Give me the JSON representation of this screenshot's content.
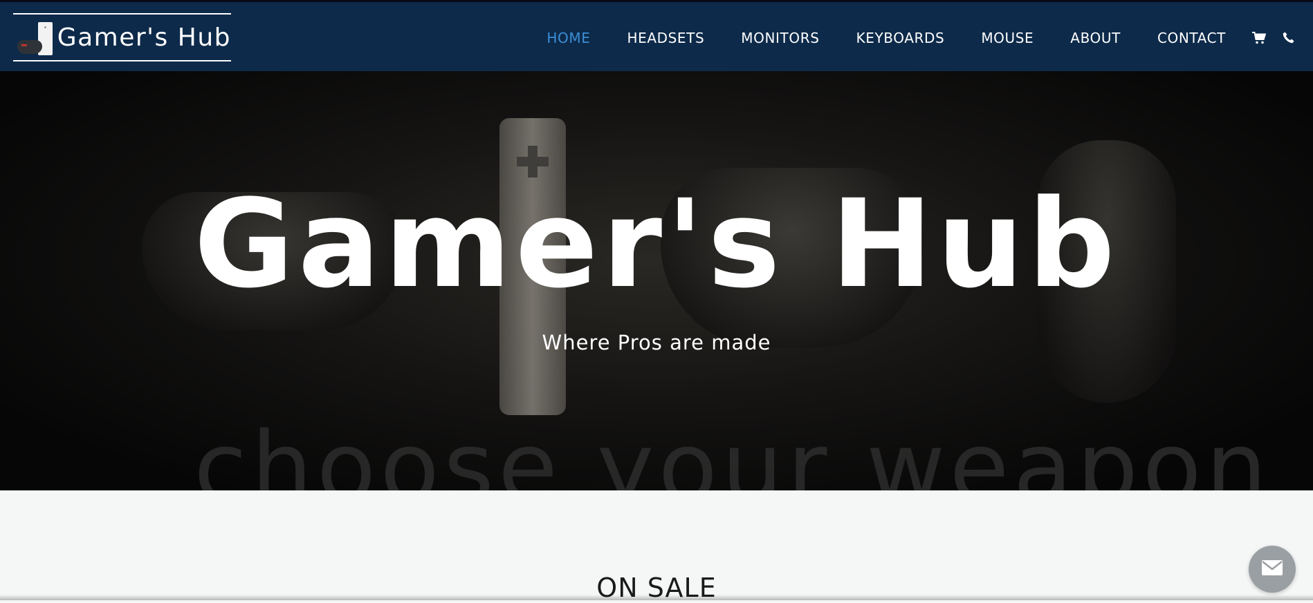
{
  "brand": {
    "name": "Gamer's Hub",
    "logo_icon": "console-controller-logo"
  },
  "nav": {
    "items": [
      {
        "label": "HOME",
        "active": true
      },
      {
        "label": "HEADSETS",
        "active": false
      },
      {
        "label": "MONITORS",
        "active": false
      },
      {
        "label": "KEYBOARDS",
        "active": false
      },
      {
        "label": "MOUSE",
        "active": false
      },
      {
        "label": "ABOUT",
        "active": false
      },
      {
        "label": "CONTACT",
        "active": false
      }
    ],
    "cart_icon": "cart-icon",
    "phone_icon": "phone-icon"
  },
  "hero": {
    "title": "Gamer's Hub",
    "subtitle": "Where Pros are made",
    "background_text": "choose your weapon"
  },
  "sections": {
    "on_sale_title": "ON SALE"
  },
  "floating": {
    "message_icon": "envelope-icon"
  },
  "colors": {
    "navbar_bg": "#0d2a4a",
    "nav_active": "#3a8fd6",
    "page_bg": "#f5f6f6",
    "msg_button_bg": "#9a9fa3"
  }
}
